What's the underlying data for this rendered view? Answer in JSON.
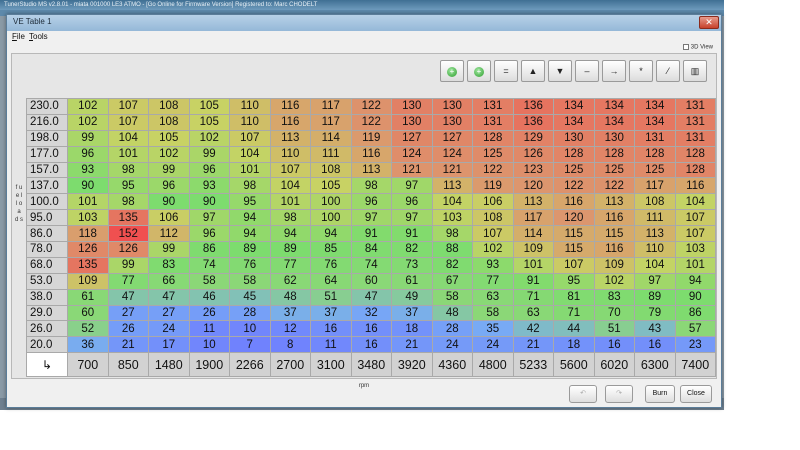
{
  "app": {
    "title_bar": "TunerStudio MS v2.8.01 - miata 001000 LE3 ATMO - [Go Online for Firmware Version] Registered to: Marc CHODELT",
    "status_text": ""
  },
  "window": {
    "title": "VE Table 1",
    "close_label": "✕"
  },
  "menu": {
    "file_first": "F",
    "file_rest": "ile",
    "tools_first": "T",
    "tools_rest": "ools"
  },
  "view3d_label": "3D View",
  "toolbar": {
    "buttons": [
      {
        "name": "increase-small-button",
        "glyph": "+"
      },
      {
        "name": "increase-button",
        "glyph": "+"
      },
      {
        "name": "set-value-button",
        "glyph": "="
      },
      {
        "name": "increment-up-button",
        "glyph": "▲"
      },
      {
        "name": "increment-down-button",
        "glyph": "▼"
      },
      {
        "name": "decrement-button",
        "glyph": "–"
      },
      {
        "name": "interpolate-button",
        "glyph": "→"
      },
      {
        "name": "multiply-button",
        "glyph": "*"
      },
      {
        "name": "smooth-button",
        "glyph": "⁄"
      },
      {
        "name": "color-palette-button",
        "glyph": "▥"
      }
    ]
  },
  "yaxis_label": "f u e l l o a d s",
  "table": {
    "corner_glyph": "↳",
    "y_axis": [
      "230.0",
      "216.0",
      "198.0",
      "177.0",
      "157.0",
      "137.0",
      "100.0",
      "95.0",
      "86.0",
      "78.0",
      "68.0",
      "53.0",
      "38.0",
      "29.0",
      "26.0",
      "20.0"
    ],
    "x_axis": [
      "700",
      "850",
      "1480",
      "1900",
      "2266",
      "2700",
      "3100",
      "3480",
      "3920",
      "4360",
      "4800",
      "5233",
      "5600",
      "6020",
      "6300",
      "7400"
    ],
    "values": [
      [
        102,
        107,
        108,
        105,
        110,
        116,
        117,
        122,
        130,
        130,
        131,
        136,
        134,
        134,
        134,
        131
      ],
      [
        102,
        107,
        108,
        105,
        110,
        116,
        117,
        122,
        130,
        130,
        131,
        136,
        134,
        134,
        134,
        131
      ],
      [
        99,
        104,
        105,
        102,
        107,
        113,
        114,
        119,
        127,
        127,
        128,
        129,
        130,
        130,
        131,
        131
      ],
      [
        96,
        101,
        102,
        99,
        104,
        110,
        111,
        116,
        124,
        124,
        125,
        126,
        128,
        128,
        128,
        128
      ],
      [
        93,
        98,
        99,
        96,
        101,
        107,
        108,
        113,
        121,
        121,
        122,
        123,
        125,
        125,
        125,
        128
      ],
      [
        90,
        95,
        96,
        93,
        98,
        104,
        105,
        98,
        97,
        113,
        119,
        120,
        122,
        122,
        117,
        116
      ],
      [
        101,
        98,
        90,
        90,
        95,
        101,
        100,
        96,
        96,
        104,
        106,
        113,
        116,
        113,
        108,
        104
      ],
      [
        103,
        135,
        106,
        97,
        94,
        98,
        100,
        97,
        97,
        103,
        108,
        117,
        120,
        116,
        111,
        107
      ],
      [
        118,
        152,
        112,
        96,
        94,
        94,
        94,
        91,
        91,
        98,
        107,
        114,
        115,
        115,
        113,
        107
      ],
      [
        126,
        126,
        99,
        86,
        89,
        89,
        85,
        84,
        82,
        88,
        102,
        109,
        115,
        116,
        110,
        103
      ],
      [
        135,
        99,
        83,
        74,
        76,
        77,
        76,
        74,
        73,
        82,
        93,
        101,
        107,
        109,
        104,
        101
      ],
      [
        109,
        77,
        66,
        58,
        58,
        62,
        64,
        60,
        61,
        67,
        77,
        91,
        95,
        102,
        97,
        94
      ],
      [
        61,
        47,
        47,
        46,
        45,
        48,
        51,
        47,
        49,
        58,
        63,
        71,
        81,
        83,
        89,
        90
      ],
      [
        60,
        27,
        27,
        26,
        28,
        37,
        37,
        32,
        37,
        48,
        58,
        63,
        71,
        70,
        79,
        86
      ],
      [
        52,
        26,
        24,
        11,
        10,
        12,
        16,
        16,
        18,
        28,
        35,
        42,
        44,
        51,
        43,
        57
      ],
      [
        36,
        21,
        17,
        10,
        7,
        8,
        11,
        16,
        21,
        24,
        24,
        21,
        18,
        16,
        16,
        23
      ]
    ]
  },
  "x_axis_label": "rpm",
  "bottom": {
    "undo_glyph": "↶",
    "redo_glyph": "↷",
    "burn_label": "Burn",
    "close_label": "Close"
  }
}
